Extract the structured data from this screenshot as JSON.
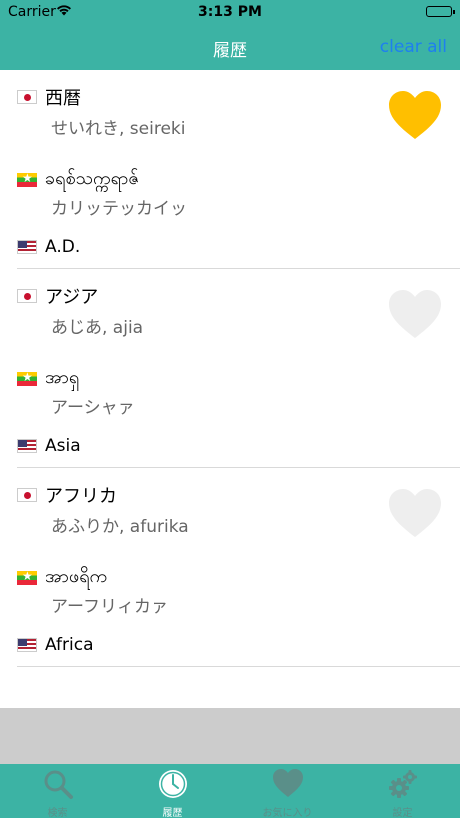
{
  "status_bar": {
    "carrier": "Carrier",
    "time": "3:13 PM"
  },
  "nav": {
    "title": "履歴",
    "clear_label": "clear all"
  },
  "history": [
    {
      "jp": {
        "word": "西暦",
        "reading": "せいれき, seireki"
      },
      "mm": {
        "word": "ခရစ်သက္ကရာဇ်",
        "reading": "カリッテッカイッ"
      },
      "en": {
        "word": "A.D."
      },
      "favorite": true
    },
    {
      "jp": {
        "word": "アジア",
        "reading": "あじあ, ajia"
      },
      "mm": {
        "word": "အာရှ",
        "reading": "アーシャァ"
      },
      "en": {
        "word": "Asia"
      },
      "favorite": false
    },
    {
      "jp": {
        "word": "アフリカ",
        "reading": "あふりか, afurika"
      },
      "mm": {
        "word": "အာဖရိက",
        "reading": "アーフリィカァ"
      },
      "en": {
        "word": "Africa"
      },
      "favorite": false
    }
  ],
  "flags": {
    "jp": "japan-flag-icon",
    "mm": "myanmar-flag-icon",
    "en": "us-flag-icon"
  },
  "colors": {
    "header": "#3cb3a4",
    "clear": "#1e7ff0",
    "heart_on": "#ffbf00",
    "heart_off": "#eeeeee"
  },
  "tabs": [
    {
      "label": "検索",
      "icon": "search-icon",
      "active": false
    },
    {
      "label": "履歴",
      "icon": "clock-icon",
      "active": true
    },
    {
      "label": "お気に入り",
      "icon": "heart-icon",
      "active": false
    },
    {
      "label": "設定",
      "icon": "gear-icon",
      "active": false
    }
  ]
}
